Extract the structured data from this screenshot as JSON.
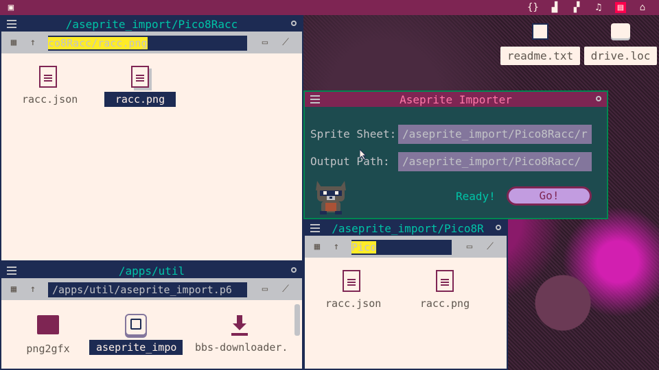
{
  "topbar": {
    "left_icon": "picotron-logo-icon",
    "right_icons": [
      "brackets-icon",
      "sprite-icon",
      "map-icon",
      "music-note-icon",
      "sfx-icon",
      "robot-icon"
    ]
  },
  "desktop": {
    "icons": [
      {
        "label": "readme.txt",
        "icon": "text-file-icon"
      },
      {
        "label": "drive.loc",
        "icon": "drive-icon"
      }
    ]
  },
  "win1": {
    "title": "/aseprite_import/Pico8Racc",
    "path_highlight": "co8Racc/racc.png",
    "files": [
      {
        "label": "racc.json",
        "selected": false
      },
      {
        "label": "racc.png",
        "selected": true
      }
    ]
  },
  "win2": {
    "title": "/apps/util",
    "path": "/apps/util/aseprite_import.p6",
    "files": [
      {
        "label": "png2gfx"
      },
      {
        "label": "aseprite_impo"
      },
      {
        "label": "bbs-downloader."
      }
    ]
  },
  "importer": {
    "title": "Aseprite Importer",
    "sprite_sheet_label": "Sprite Sheet:",
    "sprite_sheet_value": "/aseprite_import/Pico8Racc/r",
    "output_path_label": "Output Path:",
    "output_path_value": "/aseprite_import/Pico8Racc/",
    "status": "Ready!",
    "go_label": "Go!"
  },
  "win3": {
    "title": "/aseprite_import/Pico8R",
    "path_highlight": "Pico",
    "files": [
      {
        "label": "racc.json"
      },
      {
        "label": "racc.png"
      }
    ]
  },
  "colors": {
    "topbar": "#7e2553",
    "title_bg": "#1d2b53",
    "title_text": "#00c4a7",
    "window_bg": "#fff1e8",
    "highlight": "#ffec27",
    "accent_pink": "#ff77a8"
  }
}
